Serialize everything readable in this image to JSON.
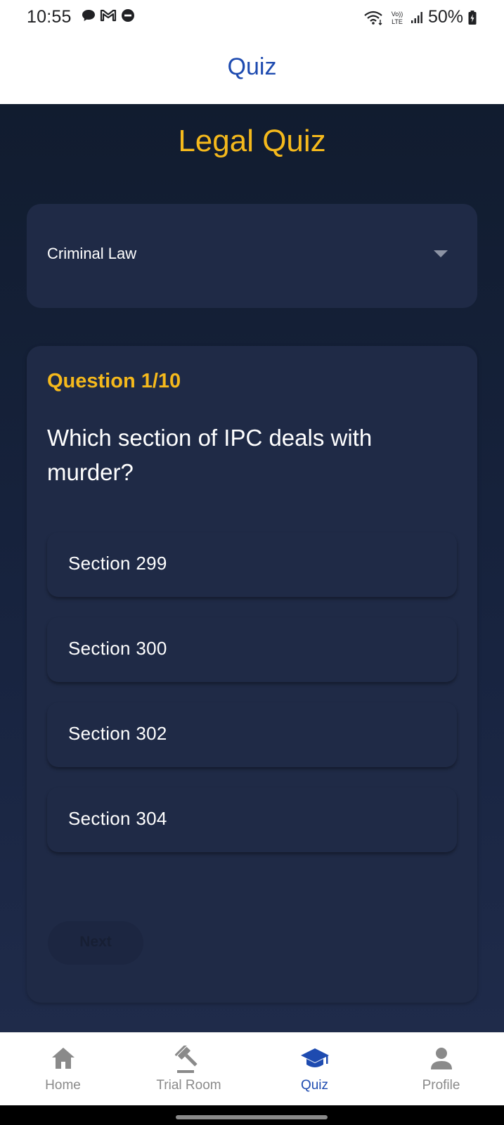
{
  "status_bar": {
    "time": "10:55",
    "battery": "50%",
    "network_label": "LTE"
  },
  "app_bar": {
    "title": "Quiz"
  },
  "page": {
    "heading": "Legal Quiz"
  },
  "category_dropdown": {
    "selected": "Criminal Law"
  },
  "quiz": {
    "progress": "Question 1/10",
    "question": "Which section of IPC deals with murder?",
    "options": [
      "Section 299",
      "Section 300",
      "Section 302",
      "Section 304"
    ],
    "next_label": "Next"
  },
  "bottom_nav": {
    "items": [
      {
        "label": "Home",
        "icon": "home-icon",
        "active": false
      },
      {
        "label": "Trial Room",
        "icon": "gavel-icon",
        "active": false
      },
      {
        "label": "Quiz",
        "icon": "graduation-cap-icon",
        "active": true
      },
      {
        "label": "Profile",
        "icon": "person-icon",
        "active": false
      }
    ]
  },
  "colors": {
    "accent_gold": "#f5b91c",
    "brand_blue": "#1e4bb0",
    "card_bg": "#1f2a46",
    "page_bg": "#111c2f",
    "inactive_nav": "#8a8a8a"
  }
}
